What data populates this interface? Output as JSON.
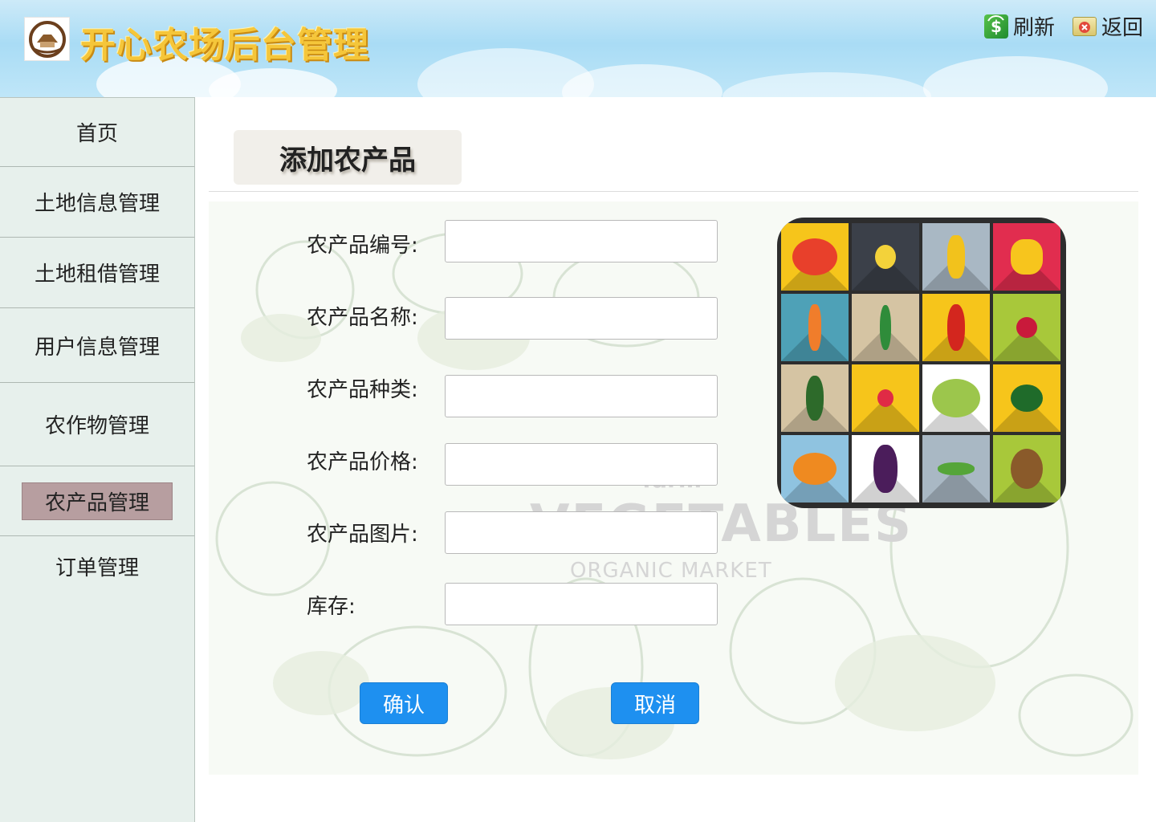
{
  "header": {
    "title": "开心农场后台管理",
    "refresh_label": "刷新",
    "back_label": "返回",
    "refresh_icon": "refresh-icon",
    "back_icon": "back-icon"
  },
  "sidebar": {
    "items": [
      {
        "label": "首页"
      },
      {
        "label": "土地信息管理"
      },
      {
        "label": "土地租借管理"
      },
      {
        "label": "用户信息管理"
      },
      {
        "label": "农作物管理"
      },
      {
        "label": "农产品管理",
        "active": true
      },
      {
        "label": "订单管理"
      }
    ]
  },
  "main": {
    "page_title": "添加农产品",
    "fields": [
      {
        "label": "农产品编号:",
        "value": ""
      },
      {
        "label": "农产品名称:",
        "value": ""
      },
      {
        "label": "农产品种类:",
        "value": ""
      },
      {
        "label": "农产品价格:",
        "value": ""
      },
      {
        "label": "农产品图片:",
        "value": ""
      },
      {
        "label": "库存:",
        "value": ""
      }
    ],
    "confirm_label": "确认",
    "cancel_label": "取消",
    "watermark": {
      "line1": "farm",
      "line2": "VEGETABLES",
      "line3": "ORGANIC MARKET"
    }
  },
  "colors": {
    "accent_button": "#1e90f0",
    "sidebar_bg": "#e7f0ec",
    "active_item": "#b79ea0",
    "title_gold": "#f5c63a"
  }
}
